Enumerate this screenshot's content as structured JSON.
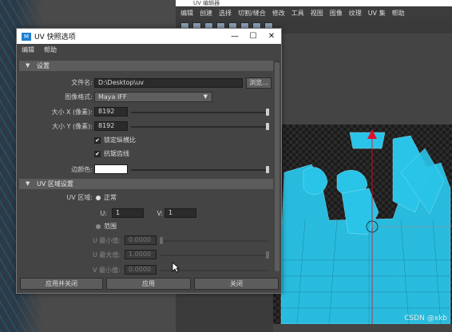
{
  "background": {
    "app_title": "UV 编辑器",
    "menu": [
      "编辑",
      "创建",
      "选择",
      "切割/缝合",
      "修改",
      "工具",
      "视图",
      "图像",
      "纹理",
      "UV 集",
      "帮助"
    ],
    "watermark": "CSDN @xkb"
  },
  "dialog": {
    "title": "UV 快照选项",
    "app_icon_label": "M",
    "window_buttons": {
      "minimize": "—",
      "maximize": "☐",
      "close": "✕"
    },
    "menu": [
      "编辑",
      "帮助"
    ],
    "settings_section": {
      "title": "设置",
      "filename_label": "文件名:",
      "filename_value": "D:\\Desktop\\uv",
      "browse_label": "浏览...",
      "image_format_label": "图像格式:",
      "image_format_value": "Maya IFF",
      "size_x_label": "大小 X (像素):",
      "size_x_value": "8192",
      "size_y_label": "大小 Y (像素):",
      "size_y_value": "8192",
      "lock_aspect_label": "锁定纵横比",
      "lock_aspect_checked": true,
      "antialias_label": "抗锯齿线",
      "antialias_checked": true,
      "edge_color_label": "边颜色:",
      "edge_color": "#ffffff"
    },
    "uv_range_section": {
      "title": "UV 区域设置",
      "uv_range_label": "UV 区域:",
      "option_normal": "正常",
      "u_label": "U:",
      "u_value": "1",
      "v_label": "V:",
      "v_value": "1",
      "option_range": "范围",
      "u_min_label": "U 最小值:",
      "u_min_value": "0.0000",
      "u_max_label": "U 最大值:",
      "u_max_value": "1.0000",
      "v_min_label": "V 最小值:",
      "v_min_value": "0.0000"
    },
    "footer": {
      "apply_close": "应用并关闭",
      "apply": "应用",
      "close": "关闭"
    }
  },
  "colors": {
    "uv_wire": "#29c4e8",
    "pivot_red": "#e0102a"
  }
}
